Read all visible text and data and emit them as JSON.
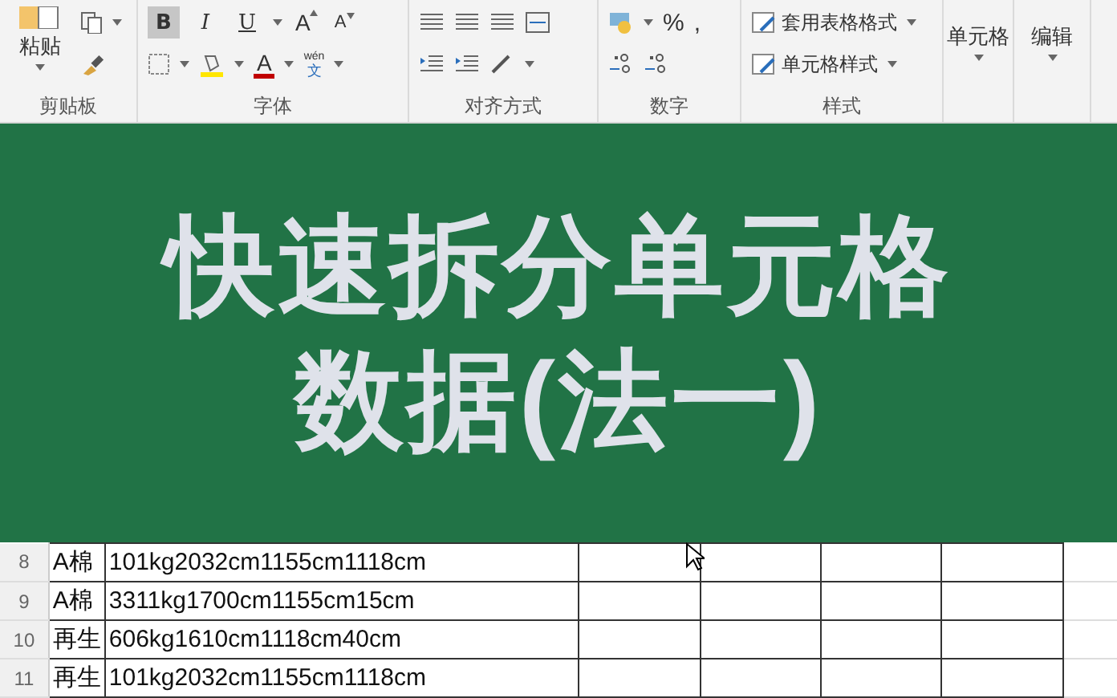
{
  "ribbon": {
    "clipboard": {
      "paste": "粘贴",
      "label": "剪贴板"
    },
    "font": {
      "buttons": [
        {
          "text": "B",
          "kind": "bold",
          "selected": true
        },
        {
          "text": "I",
          "kind": "italic",
          "selected": false
        },
        {
          "text": "U",
          "kind": "underline",
          "selected": false
        }
      ],
      "size_letters": [
        "A",
        "A"
      ],
      "color_letter": "A",
      "phonetic": [
        "wén",
        "文"
      ],
      "label": "字体"
    },
    "alignment": {
      "label": "对齐方式"
    },
    "number": {
      "symbols": [
        "%",
        ","
      ],
      "label": "数字"
    },
    "styles": {
      "items": [
        "套用表格格式",
        "单元格样式"
      ],
      "label": "样式"
    },
    "cells": "单元格",
    "editing": "编辑"
  },
  "banner": {
    "lines": [
      "快速拆分单元格",
      "数据(法一)"
    ]
  },
  "sheet": {
    "rows": [
      {
        "number": "8",
        "cells": [
          "A棉",
          "101kg2032cm1155cm1118cm"
        ]
      },
      {
        "number": "9",
        "cells": [
          "A棉",
          "3311kg1700cm1155cm15cm"
        ]
      },
      {
        "number": "10",
        "cells": [
          "再生",
          "606kg1610cm1118cm40cm"
        ]
      },
      {
        "number": "11",
        "cells": [
          "再生",
          "101kg2032cm1155cm1118cm"
        ]
      }
    ]
  }
}
